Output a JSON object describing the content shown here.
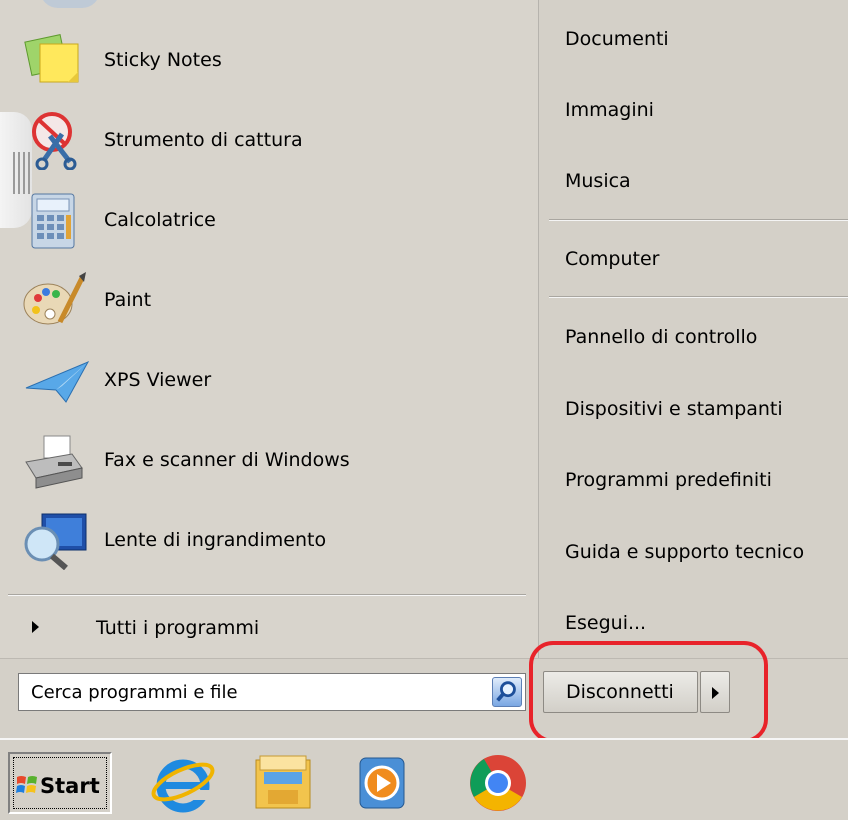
{
  "programs": [
    {
      "label": "Sticky Notes",
      "icon": "sticky-notes-icon"
    },
    {
      "label": "Strumento di cattura",
      "icon": "snipping-tool-icon"
    },
    {
      "label": "Calcolatrice",
      "icon": "calculator-icon"
    },
    {
      "label": "Paint",
      "icon": "paint-icon"
    },
    {
      "label": "XPS Viewer",
      "icon": "xps-viewer-icon"
    },
    {
      "label": "Fax e scanner di Windows",
      "icon": "fax-scanner-icon"
    },
    {
      "label": "Lente di ingrandimento",
      "icon": "magnifier-icon"
    }
  ],
  "all_programs_label": "Tutti i programmi",
  "right_items": [
    "Documenti",
    "Immagini",
    "Musica",
    "Computer",
    "Pannello di controllo",
    "Dispositivi e stampanti",
    "Programmi predefiniti",
    "Guida e supporto tecnico",
    "Esegui..."
  ],
  "search": {
    "placeholder": "Cerca programmi e file",
    "icon": "search-icon"
  },
  "disconnect": {
    "label": "Disconnetti",
    "arrow_icon": "triangle-right-icon"
  },
  "taskbar": {
    "start_label": "Start",
    "icons": [
      "internet-explorer-icon",
      "file-explorer-icon",
      "media-player-icon",
      "chrome-icon"
    ]
  },
  "colors": {
    "highlight": "#e8232a",
    "menu_bg": "#d4d0c8"
  }
}
